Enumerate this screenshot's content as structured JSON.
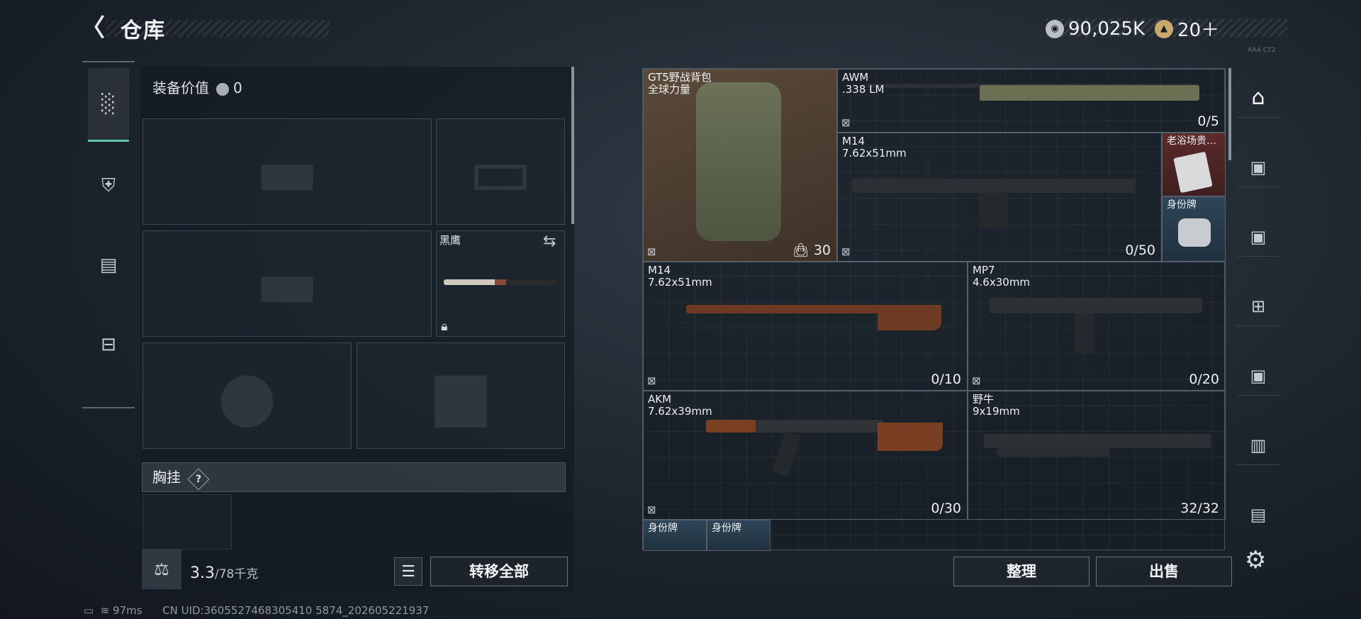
{
  "header": {
    "title": "仓库",
    "currency1": "90,025K",
    "currency2": "20＋",
    "version": "AAA CT2"
  },
  "equipment": {
    "value_label": "装备价值",
    "value": "0",
    "knife_label": "黑鹰",
    "chest_label": "胸挂",
    "chest_help": "?"
  },
  "weight": {
    "current": "3.3",
    "max": "/78千克"
  },
  "buttons": {
    "transfer_all": "转移全部",
    "organize": "整理",
    "sell": "出售"
  },
  "items": [
    {
      "name": "GT5野战背包",
      "sub": "全球力量",
      "count": "30"
    },
    {
      "name": "AWM",
      "sub": ".338 LM",
      "count": "0/5"
    },
    {
      "name": "M14",
      "sub": "7.62x51mm",
      "count": "0/50"
    },
    {
      "name": "老浴场贵…",
      "sub": "",
      "count": ""
    },
    {
      "name": "身份牌",
      "sub": "",
      "count": ""
    },
    {
      "name": "M14",
      "sub": "7.62x51mm",
      "count": "0/10"
    },
    {
      "name": "MP7",
      "sub": "4.6x30mm",
      "count": "0/20"
    },
    {
      "name": "AKM",
      "sub": "7.62x39mm",
      "count": "0/30"
    },
    {
      "name": "野牛",
      "sub": "9x19mm",
      "count": "32/32"
    },
    {
      "name": "身份牌",
      "sub": "",
      "count": ""
    },
    {
      "name": "身份牌",
      "sub": "",
      "count": ""
    }
  ],
  "status": {
    "ping": "97ms",
    "uid": "CN UID:3605527468305410 5874_202605221937"
  }
}
